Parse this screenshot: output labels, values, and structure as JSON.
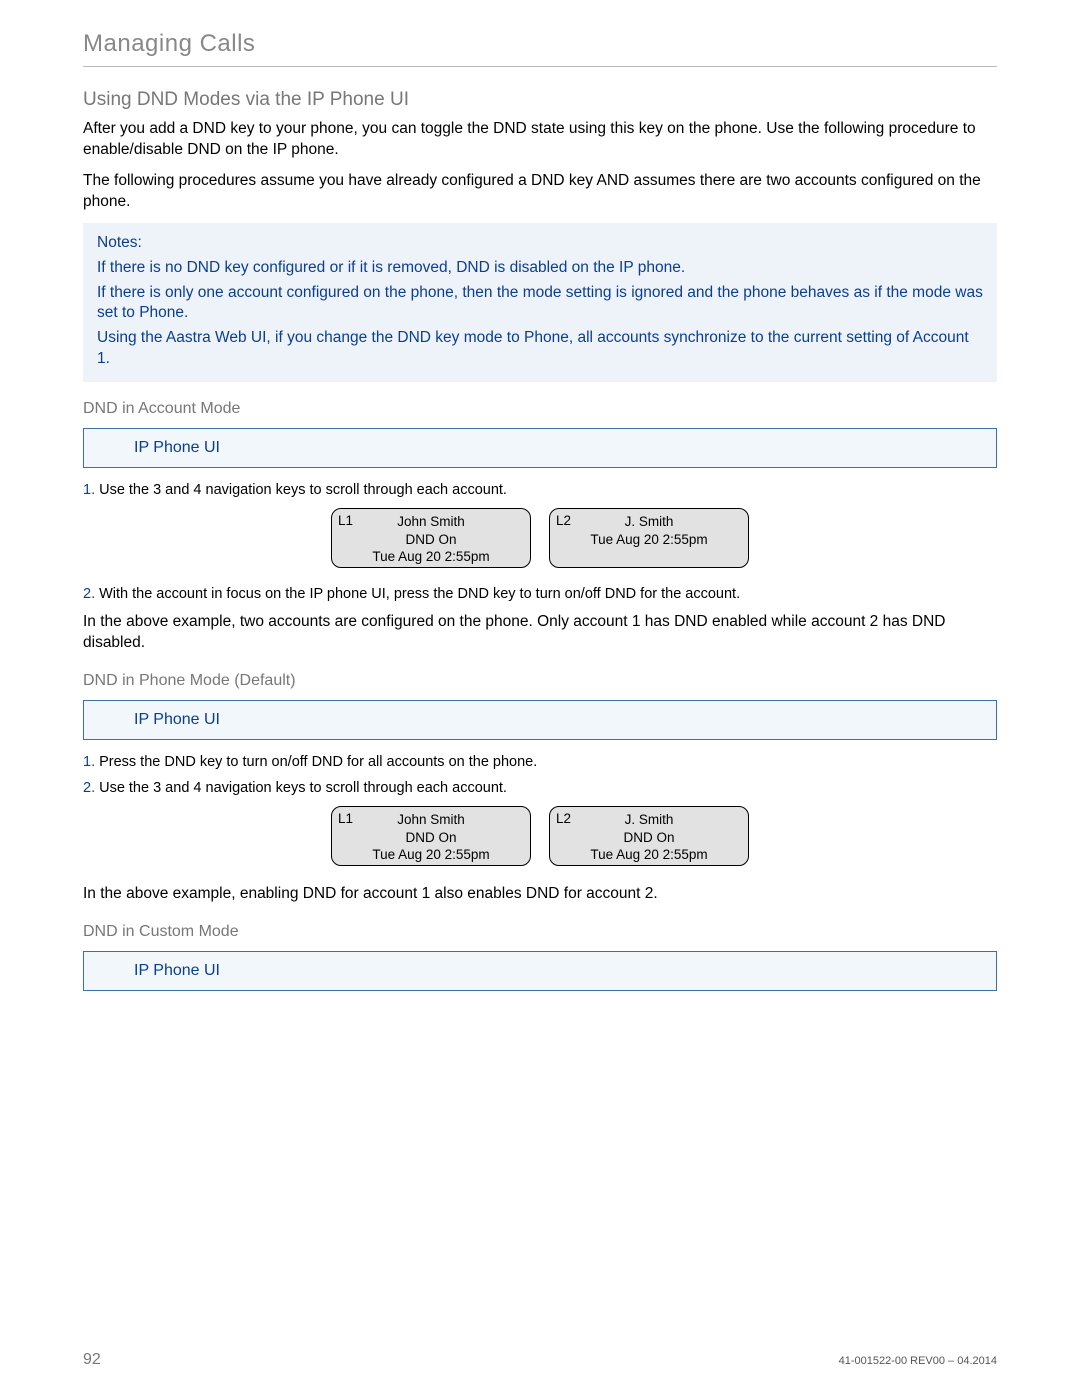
{
  "chapter": "Managing Calls",
  "section": "Using DND Modes via the IP Phone UI",
  "intro1": "After you add a DND key to your phone, you can toggle the DND state using this key on the phone. Use the following procedure to enable/disable DND on the IP phone.",
  "intro2": "The following procedures assume you have already configured a DND key AND assumes there are two accounts configured on the phone.",
  "notes": {
    "label": "Notes:",
    "items": [
      "If there is no DND key configured or if it is removed, DND is disabled on the IP phone.",
      "If there is only one account configured on the phone, then the mode setting is ignored and the phone behaves as if the mode was set to Phone.",
      "Using the Aastra Web UI, if you change the DND key mode to Phone, all accounts synchronize to the current setting of Account 1."
    ]
  },
  "accountMode": {
    "heading": "DND in Account Mode",
    "uiLabel": "IP Phone UI",
    "step1": "Use the 3  and 4  navigation keys to scroll through each account.",
    "screens": [
      {
        "line": "L1",
        "name": "John Smith",
        "status": "DND On",
        "time": "Tue Aug 20 2:55pm"
      },
      {
        "line": "L2",
        "name": "J. Smith",
        "status": "",
        "time": "Tue Aug 20 2:55pm"
      }
    ],
    "step2": "With the account in focus on the IP phone UI, press the DND key to turn on/off DND for the account.",
    "after": "In the above example, two accounts are configured on the phone. Only account 1 has DND enabled while account 2 has DND disabled."
  },
  "phoneMode": {
    "heading": "DND in Phone Mode (Default)",
    "uiLabel": "IP Phone UI",
    "step1": "Press the DND key to turn on/off DND for all accounts on the phone.",
    "step2": "Use the 3  and 4  navigation keys to scroll through each account.",
    "screens": [
      {
        "line": "L1",
        "name": "John Smith",
        "status": "DND On",
        "time": "Tue Aug 20 2:55pm"
      },
      {
        "line": "L2",
        "name": "J. Smith",
        "status": "DND On",
        "time": "Tue Aug 20 2:55pm"
      }
    ],
    "after": "In the above example, enabling DND for account 1 also enables DND for account 2."
  },
  "customMode": {
    "heading": "DND in Custom Mode",
    "uiLabel": "IP Phone UI"
  },
  "footer": {
    "page": "92",
    "docid": "41-001522-00 REV00 – 04.2014"
  }
}
